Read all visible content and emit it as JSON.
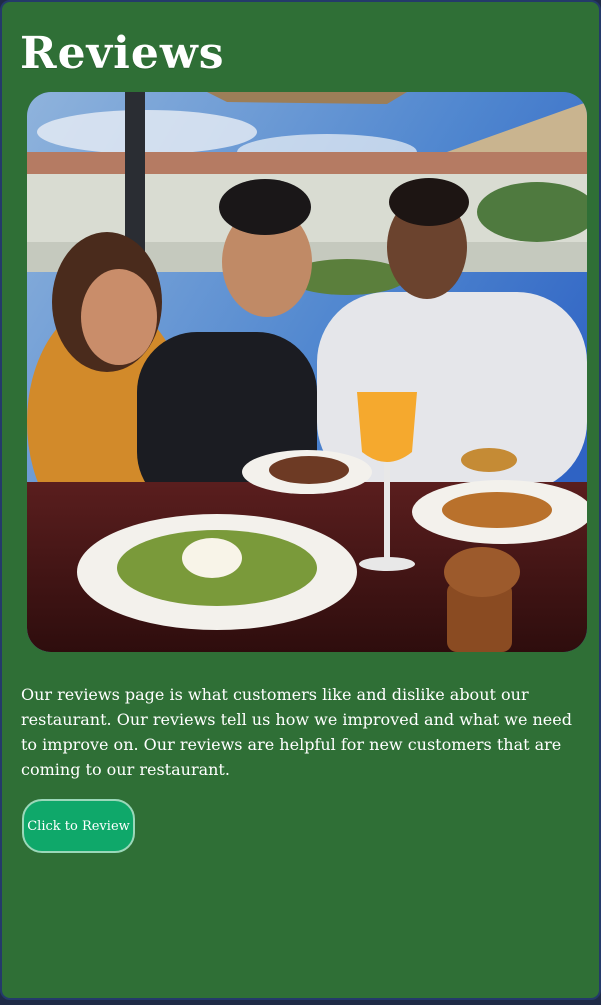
{
  "page": {
    "title": "Reviews",
    "description": "Our reviews page is what customers like and dislike about our restaurant. Our reviews tell us how we improved and what we need to improve on. Our reviews are helpful for new customers that are coming to our restaurant.",
    "button_label": "Click to Review"
  },
  "photo": {
    "subject": "three friends dining at an outdoor restaurant"
  },
  "colors": {
    "card_background": "#2f6f36",
    "page_background": "#1f2b47",
    "button_background": "#0fa86a",
    "text": "#ffffff"
  }
}
